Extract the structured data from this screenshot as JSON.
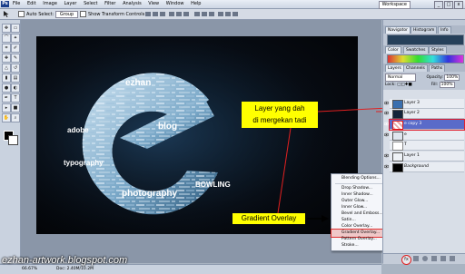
{
  "app": {
    "logo": "Ps"
  },
  "menubar": {
    "items": [
      "File",
      "Edit",
      "Image",
      "Layer",
      "Select",
      "Filter",
      "Analysis",
      "View",
      "Window",
      "Help"
    ],
    "workspace": "Workspace",
    "window_buttons": [
      "_",
      "□",
      "x"
    ]
  },
  "options_bar": {
    "auto_select_label": "Auto Select:",
    "auto_select_value": "Group",
    "show_transform_label": "Show Transform Controls"
  },
  "toolbox": {
    "tools": [
      "move-icon",
      "marquee-icon",
      "lasso-icon",
      "magic-wand-icon",
      "crop-icon",
      "eyedropper-icon",
      "healing-icon",
      "brush-icon",
      "stamp-icon",
      "history-brush-icon",
      "eraser-icon",
      "gradient-icon",
      "blur-icon",
      "dodge-icon",
      "pen-icon",
      "type-icon",
      "path-select-icon",
      "shape-icon",
      "hand-icon",
      "zoom-icon"
    ]
  },
  "artwork": {
    "words": [
      "ezhan",
      "blog",
      "adobe",
      "typography",
      "photography",
      "BOWLING",
      "ez"
    ],
    "words_shown": [
      "ezhan",
      "blog",
      "adobe",
      "BOWLING",
      "typography",
      "photography"
    ]
  },
  "callouts": {
    "layer": [
      "Layer yang dah",
      "di mergekan tadi"
    ],
    "gradient": "Gradient Overlay"
  },
  "popup_menu": {
    "items": [
      "Blending Options...",
      "Drop Shadow...",
      "Inner Shadow...",
      "Outer Glow...",
      "Inner Glow...",
      "Bevel and Emboss...",
      "Satin...",
      "Color Overlay...",
      "Gradient Overlay...",
      "Pattern Overlay...",
      "Stroke..."
    ],
    "highlighted": "Gradient Overlay..."
  },
  "panels": {
    "top_tabs": [
      "Navigator",
      "Histogram",
      "Info"
    ],
    "mid_tabs": [
      "Color",
      "Swatches",
      "Styles"
    ],
    "layer_tabs": [
      "Layers",
      "Channels",
      "Paths"
    ],
    "blend_mode": "Normal",
    "opacity_label": "Opacity:",
    "opacity_value": "100%",
    "lock_label": "Lock:",
    "fill_label": "Fill:",
    "fill_value": "100%",
    "layers": [
      {
        "name": "Layer 3"
      },
      {
        "name": "Layer 2"
      },
      {
        "name": "e copy 3",
        "selected": true
      },
      {
        "name": "e"
      },
      {
        "name": "T"
      },
      {
        "name": "Layer 1"
      },
      {
        "name": "Background"
      }
    ]
  },
  "status": {
    "zoom": "66.67%",
    "doc": "Doc: 2.40M/10.2M"
  },
  "watermark": "ezhan-artwork.blogspot.com",
  "colors": {
    "highlight": "#e02020",
    "callout_bg": "#ffff00",
    "selected_layer": "#5a6bc9",
    "canvas_bg": "#050a10"
  }
}
